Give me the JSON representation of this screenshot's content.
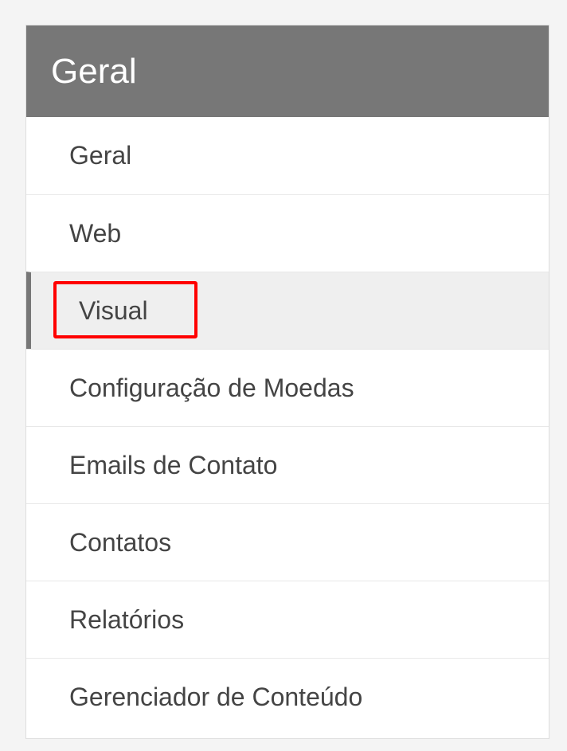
{
  "panel": {
    "title": "Geral",
    "items": [
      {
        "label": "Geral"
      },
      {
        "label": "Web"
      },
      {
        "label": "Visual"
      },
      {
        "label": "Configuração de Moedas"
      },
      {
        "label": "Emails de Contato"
      },
      {
        "label": "Contatos"
      },
      {
        "label": "Relatórios"
      },
      {
        "label": "Gerenciador de Conteúdo"
      }
    ],
    "active_item": "Visual"
  },
  "colors": {
    "header_bg": "#777777",
    "active_bg": "#efefef",
    "highlight": "#ff0000",
    "page_bg": "#f4f4f4"
  }
}
